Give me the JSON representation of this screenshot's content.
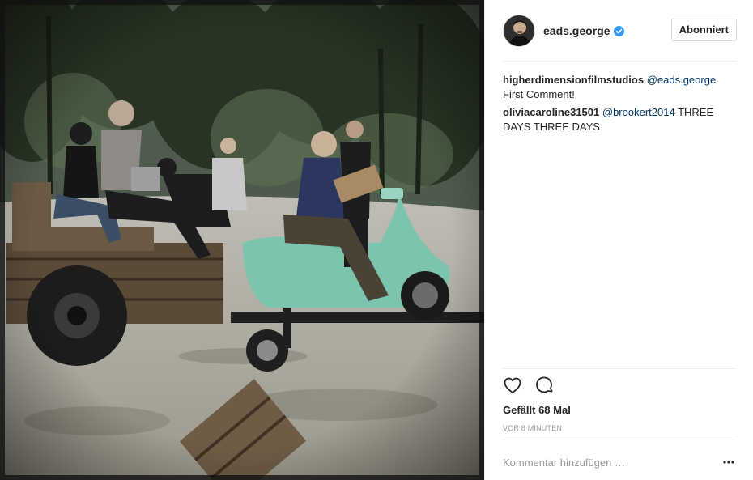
{
  "post": {
    "photo_icon": "post-photo",
    "author": {
      "username": "eads.george",
      "verified": true,
      "verified_icon": "verified-badge-icon"
    },
    "follow_button_label": "Abonniert",
    "comments": [
      {
        "user": "higherdimensionfilmstudios",
        "mention": "@eads.george",
        "text": "First Comment!"
      },
      {
        "user": "oliviacaroline31501",
        "mention": "@brookert2014",
        "text": "THREE DAYS THREE DAYS"
      }
    ],
    "actions": {
      "like_icon": "heart-icon",
      "comment_icon": "comment-bubble-icon"
    },
    "likes_text": "Gefällt 68 Mal",
    "timestamp": "VOR 8 MINUTEN",
    "comment_input": {
      "placeholder": "Kommentar hinzufügen …",
      "value": ""
    },
    "more_icon": "more-options-icon",
    "colors": {
      "mention": "#003569",
      "verified": "#3897f0",
      "text": "#262626",
      "muted": "#999999",
      "divider": "#efefef"
    }
  }
}
